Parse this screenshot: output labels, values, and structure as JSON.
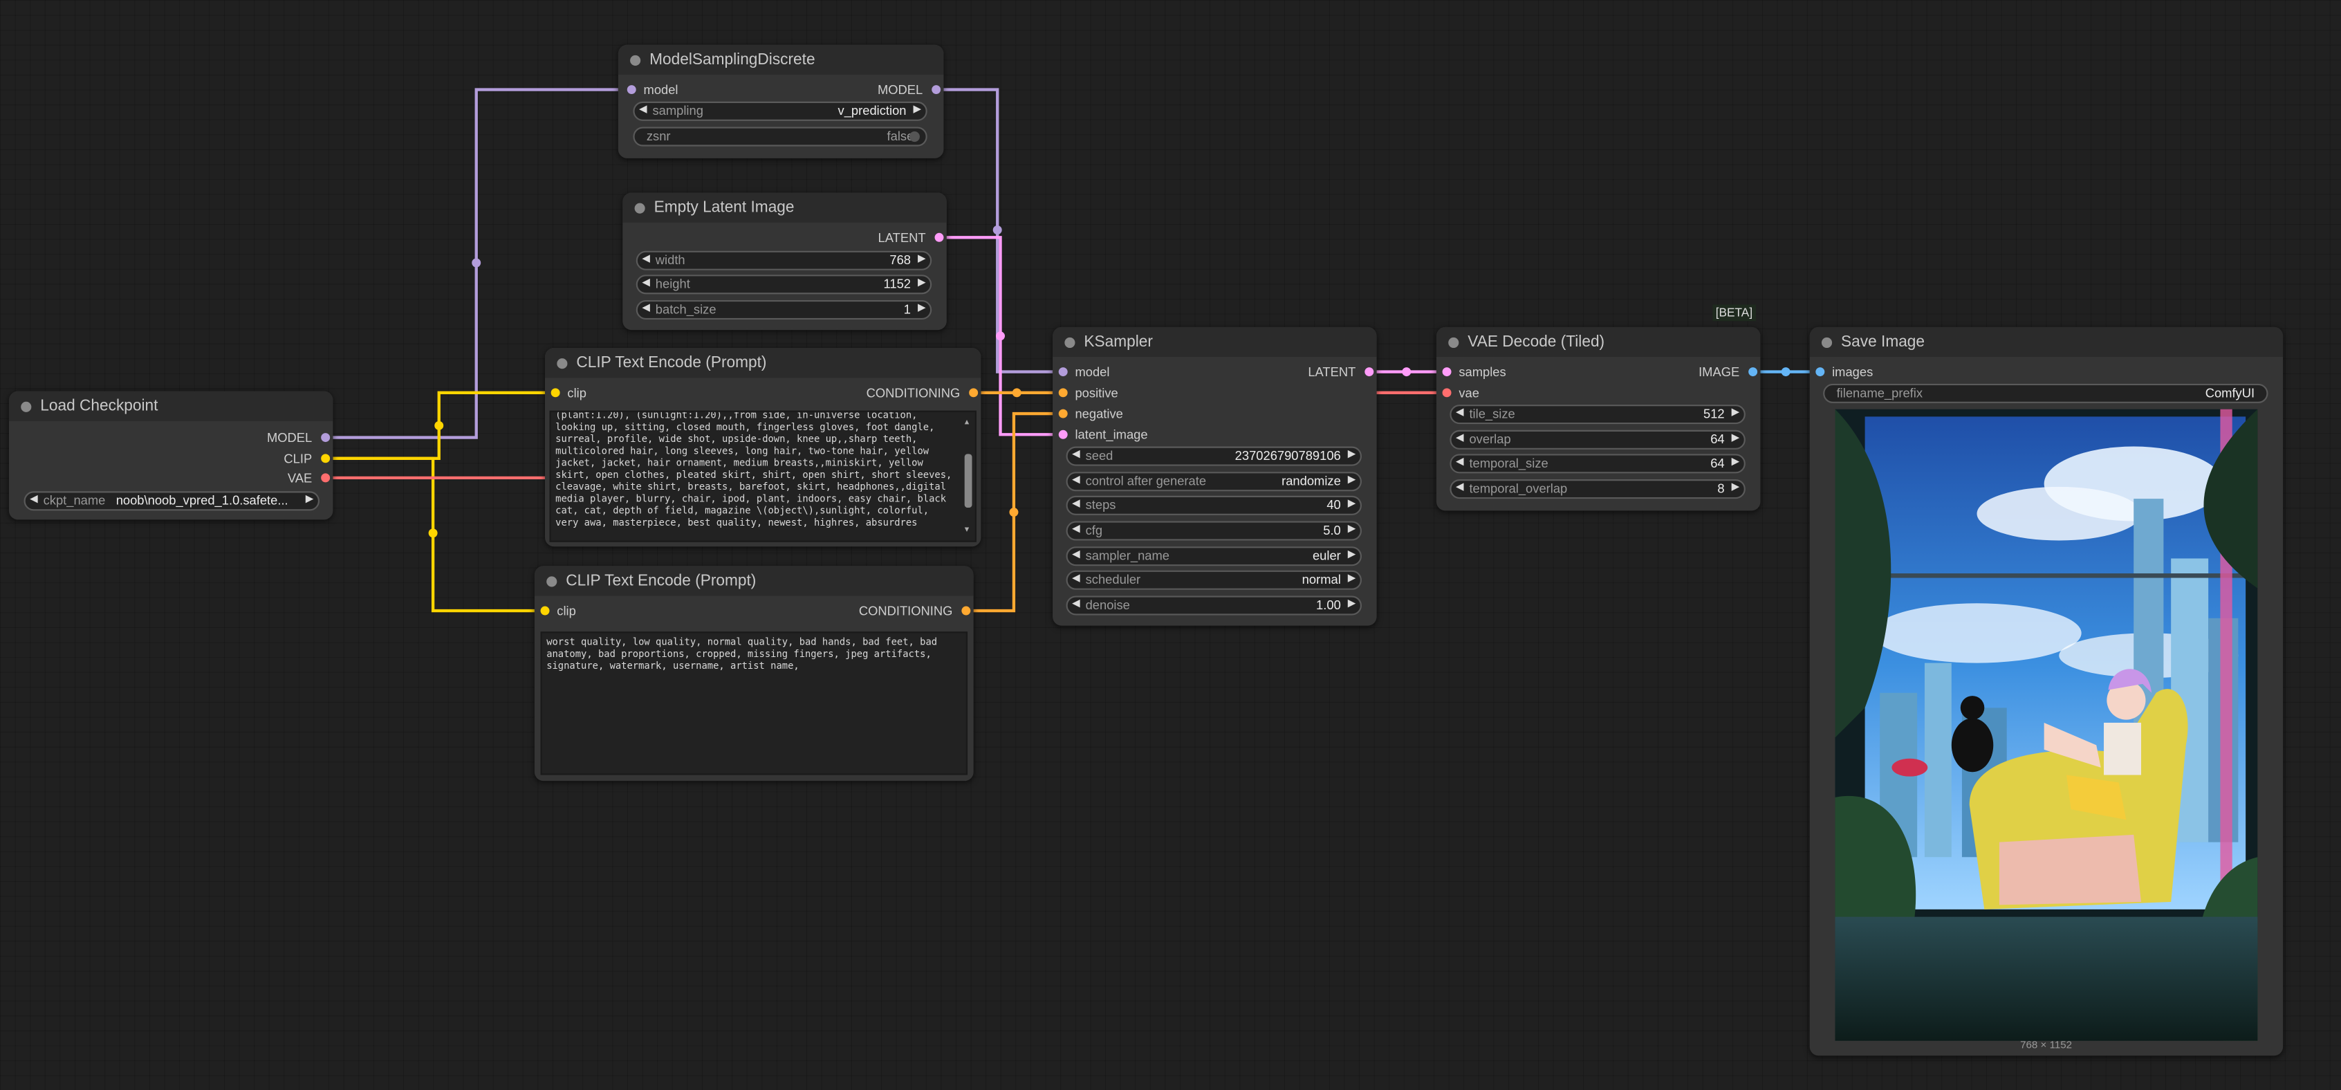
{
  "colors": {
    "model": "#b39ddb",
    "clip": "#ffd500",
    "vae": "#ff6e6e",
    "conditioning": "#ffa931",
    "latent": "#ff9cf9",
    "image": "#64b5f6",
    "node_bg": "#353535",
    "title_bg": "#2b2b2b",
    "canvas_bg": "#202020"
  },
  "nodes": {
    "model_sampling": {
      "title": "ModelSamplingDiscrete",
      "input_model": "model",
      "output_model": "MODEL",
      "sampling_label": "sampling",
      "sampling_value": "v_prediction",
      "zsnr_label": "zsnr",
      "zsnr_value": "false"
    },
    "empty_latent": {
      "title": "Empty Latent Image",
      "output_latent": "LATENT",
      "width_label": "width",
      "width_value": "768",
      "height_label": "height",
      "height_value": "1152",
      "batch_label": "batch_size",
      "batch_value": "1"
    },
    "load_checkpoint": {
      "title": "Load Checkpoint",
      "out_model": "MODEL",
      "out_clip": "CLIP",
      "out_vae": "VAE",
      "ckpt_label": "ckpt_name",
      "ckpt_value": "noob\\noob_vpred_1.0.safete..."
    },
    "clip_pos": {
      "title": "CLIP Text Encode (Prompt)",
      "input_clip": "clip",
      "output_cond": "CONDITIONING",
      "text": "(plant:1.20), (sunlight:1.20),,from side, in-universe location, looking up, sitting, closed mouth, fingerless gloves, foot dangle, surreal, profile, wide shot, upside-down, knee up,,sharp teeth, multicolored hair, long sleeves, long hair, two-tone hair, yellow jacket, jacket, hair ornament, medium breasts,,miniskirt, yellow skirt, open clothes, pleated skirt, shirt, open shirt, short sleeves, cleavage, white shirt, breasts, barefoot, skirt, headphones,,digital media player, blurry, chair, ipod, plant, indoors, easy chair, black cat, cat, depth of field, magazine \\(object\\),sunlight, colorful, very awa, masterpiece, best quality, newest, highres, absurdres"
    },
    "clip_neg": {
      "title": "CLIP Text Encode (Prompt)",
      "input_clip": "clip",
      "output_cond": "CONDITIONING",
      "text": "worst quality, low quality, normal quality, bad hands, bad feet, bad anatomy, bad proportions, cropped, missing fingers, jpeg artifacts, signature, watermark, username, artist name,"
    },
    "ksampler": {
      "title": "KSampler",
      "in_model": "model",
      "in_positive": "positive",
      "in_negative": "negative",
      "in_latent": "latent_image",
      "out_latent": "LATENT",
      "seed_label": "seed",
      "seed_value": "237026790789106",
      "cag_label": "control after generate",
      "cag_value": "randomize",
      "steps_label": "steps",
      "steps_value": "40",
      "cfg_label": "cfg",
      "cfg_value": "5.0",
      "sampler_label": "sampler_name",
      "sampler_value": "euler",
      "scheduler_label": "scheduler",
      "scheduler_value": "normal",
      "denoise_label": "denoise",
      "denoise_value": "1.00"
    },
    "vae_decode": {
      "badge": "[BETA]",
      "title": "VAE Decode (Tiled)",
      "in_samples": "samples",
      "in_vae": "vae",
      "out_image": "IMAGE",
      "tile_label": "tile_size",
      "tile_value": "512",
      "overlap_label": "overlap",
      "overlap_value": "64",
      "tsize_label": "temporal_size",
      "tsize_value": "64",
      "toverlap_label": "temporal_overlap",
      "toverlap_value": "8"
    },
    "save_image": {
      "title": "Save Image",
      "in_images": "images",
      "prefix_label": "filename_prefix",
      "prefix_value": "ComfyUI",
      "preview_size": "768 × 1152"
    }
  }
}
